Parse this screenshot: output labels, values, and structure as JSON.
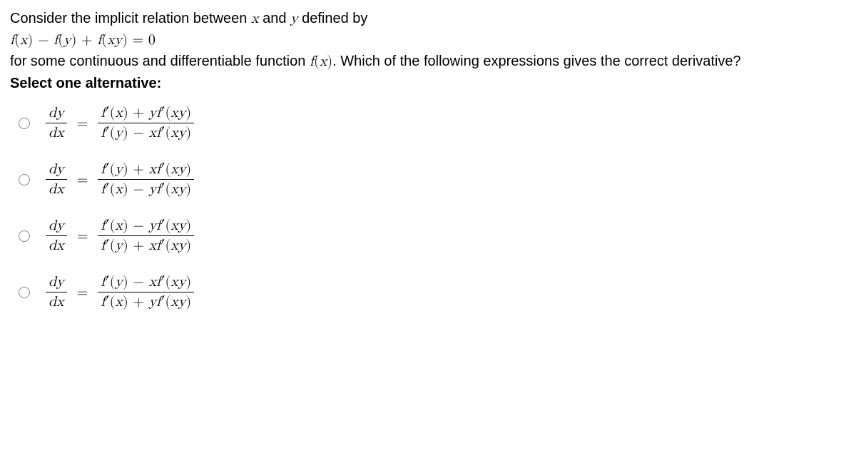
{
  "question": {
    "intro_text": "Consider the implicit relation between x and y defined by",
    "equation": "f(x) − f(y) + f(xy) = 0",
    "followup_text": "for some continuous and differentiable function f(x). Which of the following expressions gives the correct derivative?",
    "select_prompt": "Select one alternative:"
  },
  "options": [
    {
      "lhs_num": "dy",
      "lhs_den": "dx",
      "rhs_num": "f′(x) + yf′(xy)",
      "rhs_den": "f′(y) − xf′(xy)"
    },
    {
      "lhs_num": "dy",
      "lhs_den": "dx",
      "rhs_num": "f′(y) + xf′(xy)",
      "rhs_den": "f′(x) − yf′(xy)"
    },
    {
      "lhs_num": "dy",
      "lhs_den": "dx",
      "rhs_num": "f′(x) − yf′(xy)",
      "rhs_den": "f′(y) + xf′(xy)"
    },
    {
      "lhs_num": "dy",
      "lhs_den": "dx",
      "rhs_num": "f′(y) − xf′(xy)",
      "rhs_den": "f′(x) + yf′(xy)"
    }
  ]
}
